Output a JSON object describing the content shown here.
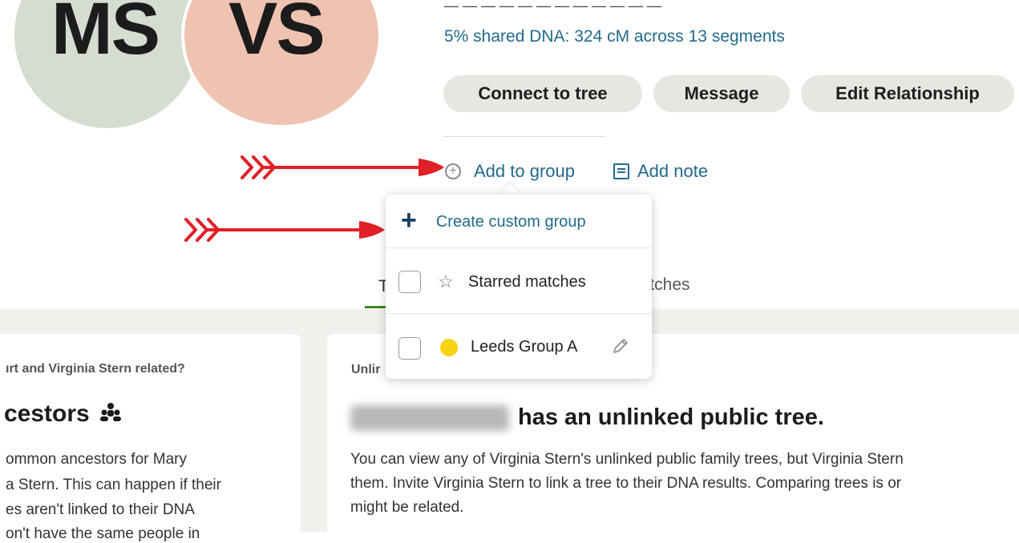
{
  "avatars": {
    "left_initials": "MS",
    "right_initials": "VS"
  },
  "match": {
    "partial_line": "— — — — — — — — — — — —",
    "shared_dna": "5% shared DNA: 324 cM across 13 segments"
  },
  "actions": {
    "connect": "Connect to tree",
    "message": "Message",
    "edit": "Edit Relationship",
    "add_group": "Add to group",
    "add_note": "Add note"
  },
  "popup": {
    "create": "Create custom group",
    "groups": [
      {
        "label": "Starred matches",
        "icon": "star-icon"
      },
      {
        "label": "Leeds Group A",
        "color": "#f7d311",
        "icon": "pencil-icon"
      }
    ]
  },
  "tabs": {
    "first": "T",
    "second": "latches"
  },
  "left_card": {
    "question": "ırt and Virginia Stern related?",
    "heading": "cestors",
    "lines": [
      "ommon ancestors for Mary",
      "a Stern. This can happen if their",
      "es aren't linked to their DNA",
      "on't have the same people in"
    ]
  },
  "right_card": {
    "label": "Unlir",
    "heading": "has an unlinked public tree.",
    "lines": [
      "You can view any of Virginia Stern's unlinked public family trees, but Virginia Stern",
      "them. Invite Virginia Stern to link a tree to their DNA results. Comparing trees is or",
      "might be related."
    ]
  },
  "colors": {
    "link": "#226a8c",
    "arrow": "#e11f26",
    "tab_active": "#3b8a1f"
  }
}
